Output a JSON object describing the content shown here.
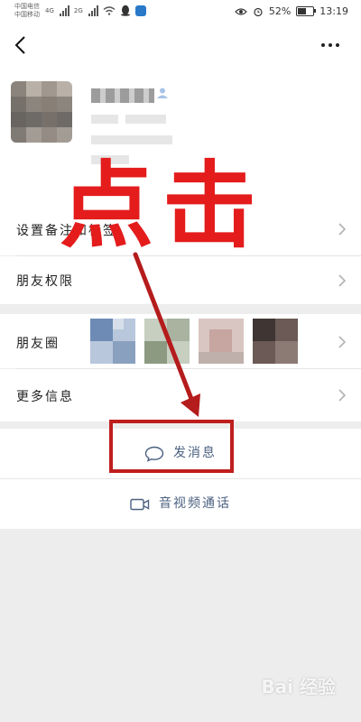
{
  "status_bar": {
    "carrier_1": "中国电信",
    "carrier_2": "中国移动",
    "net_1": "4G",
    "net_2": "2G",
    "battery": "52%",
    "battery_level": 0.52,
    "time": "13:19"
  },
  "list": {
    "remark_label": "设置备注和标签",
    "permission_label": "朋友权限",
    "moments_label": "朋友圈",
    "more_info_label": "更多信息"
  },
  "actions": {
    "send_message": "发消息",
    "av_call": "音视频通话"
  },
  "annotation": {
    "text": "点击"
  },
  "watermark": "Bai 经验",
  "colors": {
    "annotation_red": "#e41c1c",
    "action_text": "#4b6080",
    "page_bg": "#ededed"
  }
}
